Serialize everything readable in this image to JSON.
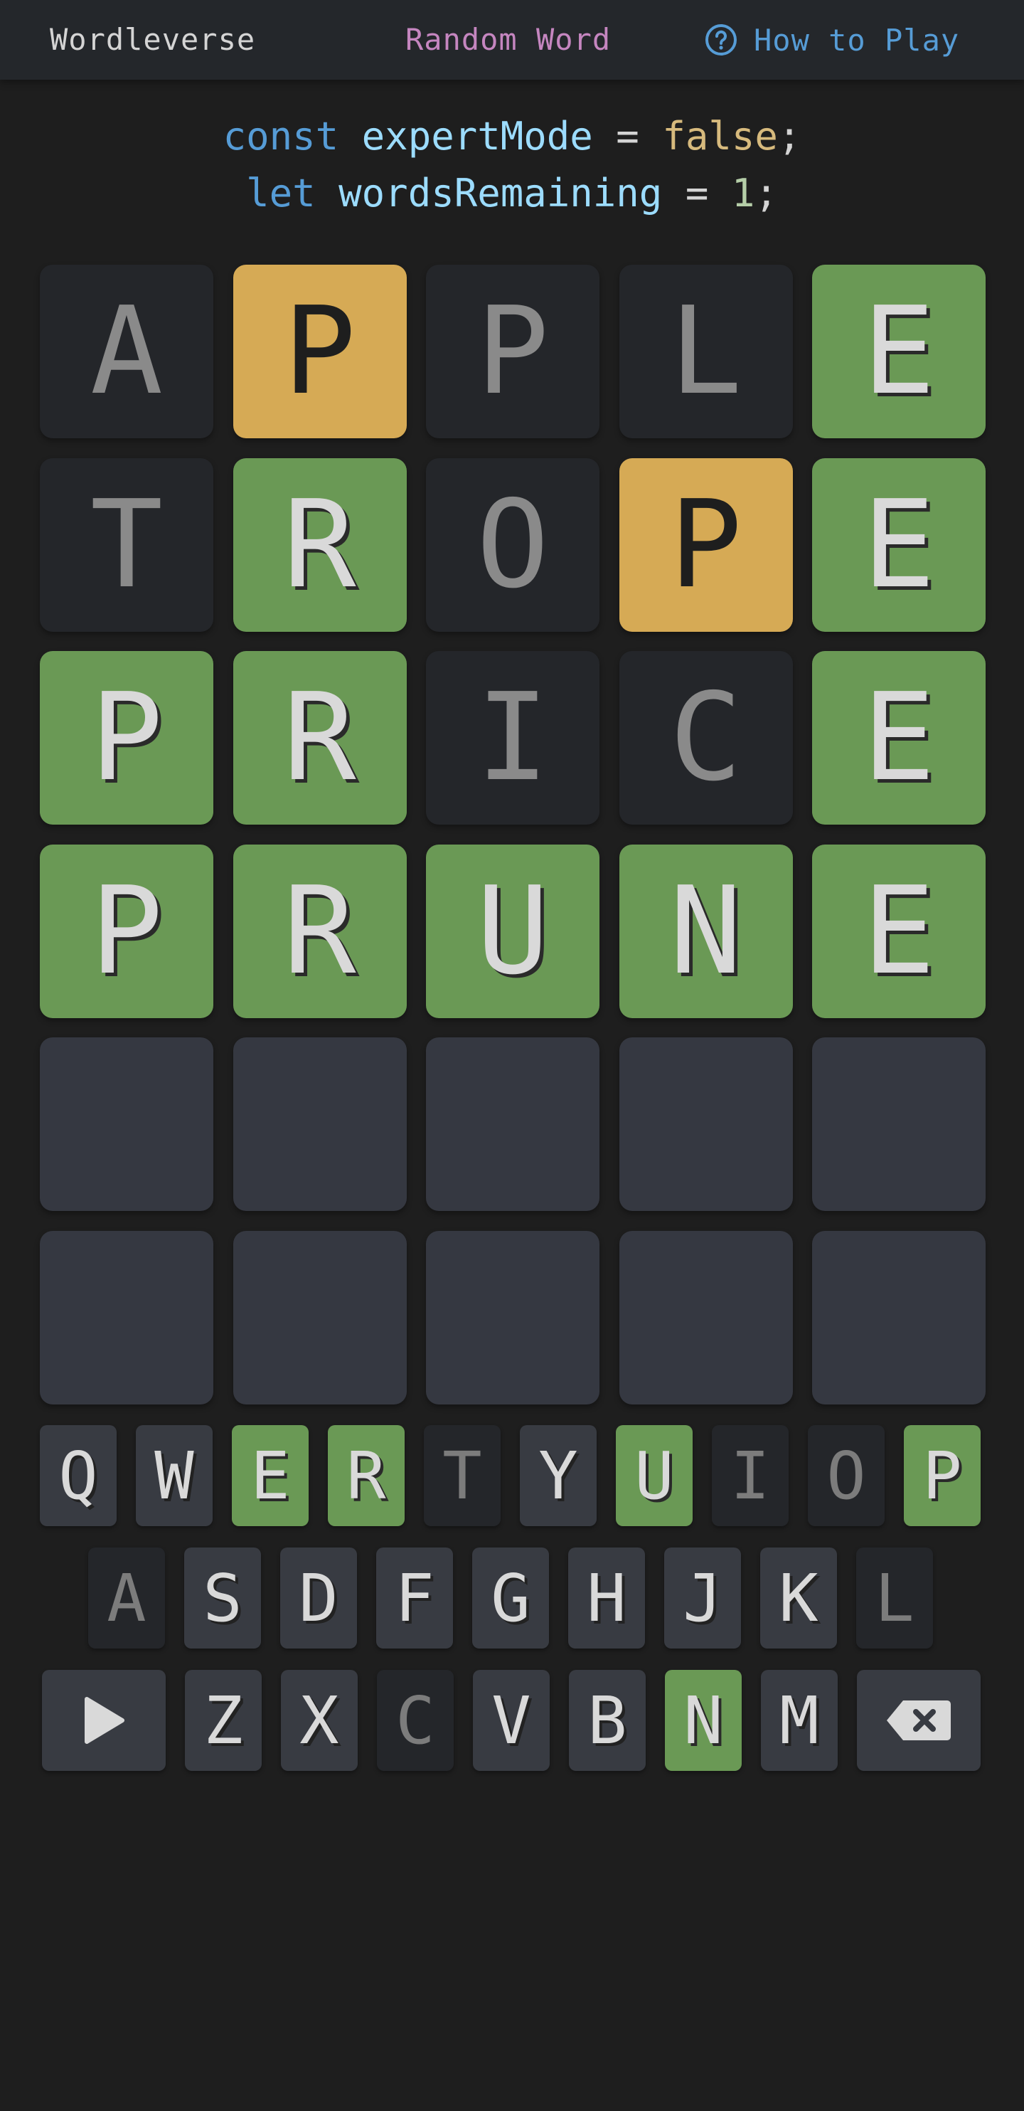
{
  "nav": {
    "brand": "Wordleverse",
    "random": "Random Word",
    "help": "How to Play",
    "help_icon": "question-circle-icon"
  },
  "code": {
    "line1": {
      "keyword": "const",
      "name": "expertMode",
      "op": "=",
      "value": "false",
      "end": ";"
    },
    "line2": {
      "keyword": "let",
      "name": "wordsRemaining",
      "op": "=",
      "value": "1",
      "end": ";"
    }
  },
  "board": {
    "rows": [
      {
        "letters": [
          "A",
          "P",
          "P",
          "L",
          "E"
        ],
        "states": [
          "absent",
          "present",
          "absent",
          "absent",
          "correct"
        ]
      },
      {
        "letters": [
          "T",
          "R",
          "O",
          "P",
          "E"
        ],
        "states": [
          "absent",
          "correct",
          "absent",
          "present",
          "correct"
        ]
      },
      {
        "letters": [
          "P",
          "R",
          "I",
          "C",
          "E"
        ],
        "states": [
          "correct",
          "correct",
          "absent",
          "absent",
          "correct"
        ]
      },
      {
        "letters": [
          "P",
          "R",
          "U",
          "N",
          "E"
        ],
        "states": [
          "correct",
          "correct",
          "correct",
          "correct",
          "correct"
        ]
      },
      {
        "letters": [
          "",
          "",
          "",
          "",
          ""
        ],
        "states": [
          "empty",
          "empty",
          "empty",
          "empty",
          "empty"
        ]
      },
      {
        "letters": [
          "",
          "",
          "",
          "",
          ""
        ],
        "states": [
          "empty",
          "empty",
          "empty",
          "empty",
          "empty"
        ]
      }
    ]
  },
  "keyboard": {
    "row1": [
      {
        "key": "Q",
        "state": "unused"
      },
      {
        "key": "W",
        "state": "unused"
      },
      {
        "key": "E",
        "state": "correct"
      },
      {
        "key": "R",
        "state": "correct"
      },
      {
        "key": "T",
        "state": "absent"
      },
      {
        "key": "Y",
        "state": "unused"
      },
      {
        "key": "U",
        "state": "correct"
      },
      {
        "key": "I",
        "state": "absent"
      },
      {
        "key": "O",
        "state": "absent"
      },
      {
        "key": "P",
        "state": "correct"
      }
    ],
    "row2": [
      {
        "key": "A",
        "state": "absent"
      },
      {
        "key": "S",
        "state": "unused"
      },
      {
        "key": "D",
        "state": "unused"
      },
      {
        "key": "F",
        "state": "unused"
      },
      {
        "key": "G",
        "state": "unused"
      },
      {
        "key": "H",
        "state": "unused"
      },
      {
        "key": "J",
        "state": "unused"
      },
      {
        "key": "K",
        "state": "unused"
      },
      {
        "key": "L",
        "state": "absent"
      }
    ],
    "row3": [
      {
        "key": "Z",
        "state": "unused"
      },
      {
        "key": "X",
        "state": "unused"
      },
      {
        "key": "C",
        "state": "absent"
      },
      {
        "key": "V",
        "state": "unused"
      },
      {
        "key": "B",
        "state": "unused"
      },
      {
        "key": "N",
        "state": "correct"
      },
      {
        "key": "M",
        "state": "unused"
      }
    ],
    "enter_icon": "play-icon",
    "backspace_icon": "backspace-icon"
  },
  "colors": {
    "correct": "#6a9955",
    "present": "#d6aa55",
    "absent": "#24262a",
    "empty": "#353841",
    "background": "#1e1e1e"
  }
}
